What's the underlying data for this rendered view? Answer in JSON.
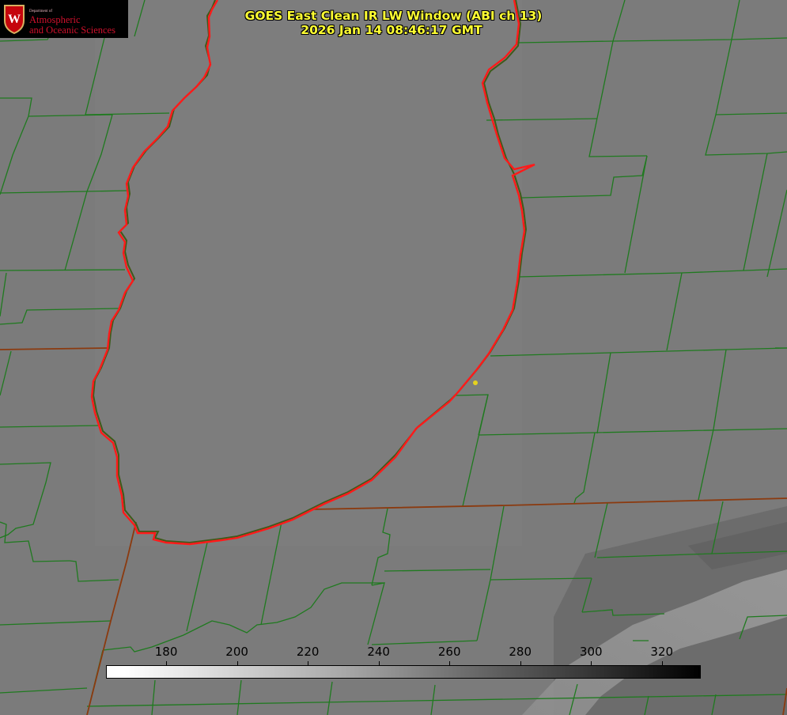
{
  "title": {
    "line1": "GOES East Clean IR LW Window (ABI ch 13)",
    "line2": "2026 Jan 14 08:46:17 GMT"
  },
  "logo": {
    "dept": "Department of",
    "line1": "Atmospheric",
    "line2": "and Oceanic Sciences",
    "crest_letter": "W"
  },
  "colorbar": {
    "ticks": [
      "180",
      "200",
      "220",
      "240",
      "260",
      "280",
      "300",
      "320"
    ],
    "tick_values": [
      180,
      200,
      220,
      240,
      260,
      280,
      300,
      320
    ],
    "range": [
      163,
      331
    ],
    "colormap": "white-to-black (cold bright, warm dark)"
  },
  "colors": {
    "background_gray": "#7c7c7c",
    "county_lines": "#1f7a1f",
    "state_lines": "#8b3a0f",
    "coastline": "#ff1a1a",
    "title_text": "#ffff33",
    "marker": "#e6d21e"
  }
}
